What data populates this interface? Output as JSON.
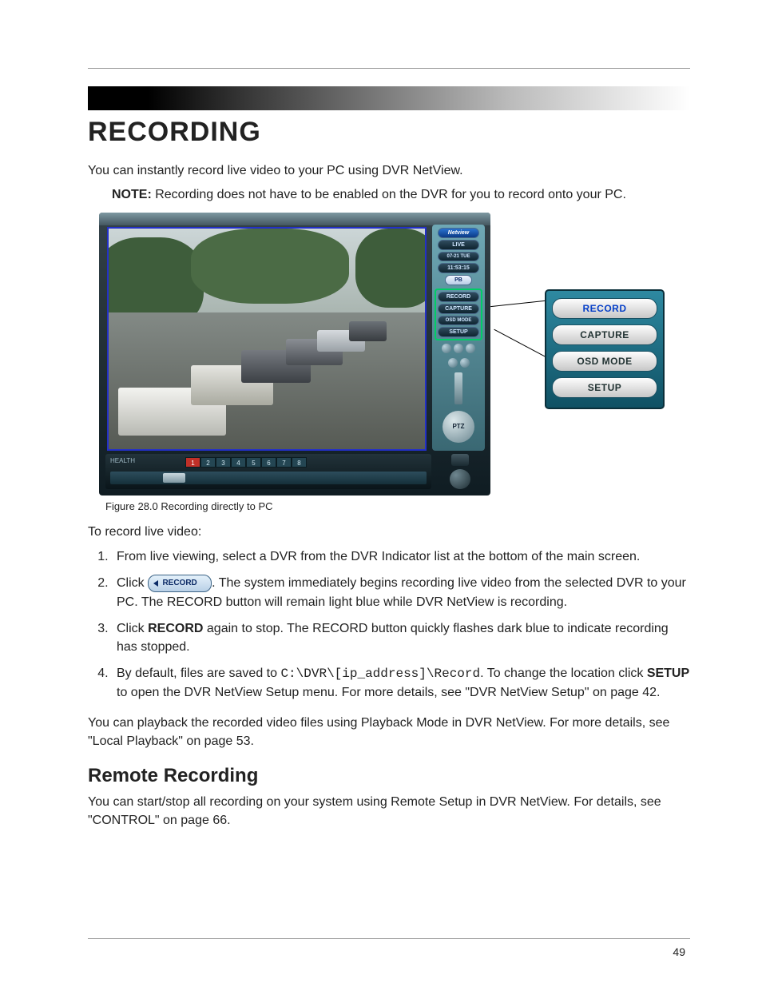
{
  "heading": "RECORDING",
  "intro": "You can instantly record live video to your PC using DVR NetView.",
  "note": {
    "label": "NOTE:",
    "text": " Recording does not have to be enabled on the DVR for you to record onto your PC."
  },
  "screenshot_side": {
    "brand": "Netview",
    "live": "LIVE",
    "date": "07-21 TUE",
    "time": "11:53:15",
    "pb": "PB",
    "record": "RECORD",
    "capture": "CAPTURE",
    "osd": "OSD MODE",
    "setup": "SETUP",
    "ptz": "PTZ"
  },
  "bottombar": {
    "health": "HEALTH",
    "channels": [
      "1",
      "2",
      "3",
      "4",
      "5",
      "6",
      "7",
      "8"
    ]
  },
  "detail_buttons": {
    "record": "RECORD",
    "capture": "CAPTURE",
    "osd": "OSD MODE",
    "setup": "SETUP"
  },
  "caption": "Figure 28.0 Recording directly to PC",
  "lead_in": "To record live video:",
  "steps": {
    "s1": "From live viewing, select a DVR from the DVR Indicator list at the bottom of the main screen.",
    "s2a": "Click ",
    "s2_btn": "RECORD",
    "s2b": ". The system immediately begins recording live video from the selected DVR to your PC. The RECORD button will remain light blue while DVR NetView is recording.",
    "s3a": "Click ",
    "s3_bold": "RECORD",
    "s3b": " again to stop. The RECORD button quickly flashes dark blue to indicate recording has stopped.",
    "s4a": "By default, files are saved to ",
    "s4_path": "C:\\DVR\\[ip_address]\\Record",
    "s4b": ". To change the location click ",
    "s4_bold": "SETUP",
    "s4c": " to open the DVR NetView Setup menu. For more details, see \"DVR NetView Setup\" on page 42."
  },
  "para_playback": "You can playback the recorded video files using Playback Mode in DVR NetView. For more details, see \"Local Playback\" on page 53.",
  "subheading": "Remote Recording",
  "para_remote": "You can start/stop all recording on your system using Remote Setup in DVR NetView. For details, see \"CONTROL\" on page 66.",
  "page_number": "49"
}
